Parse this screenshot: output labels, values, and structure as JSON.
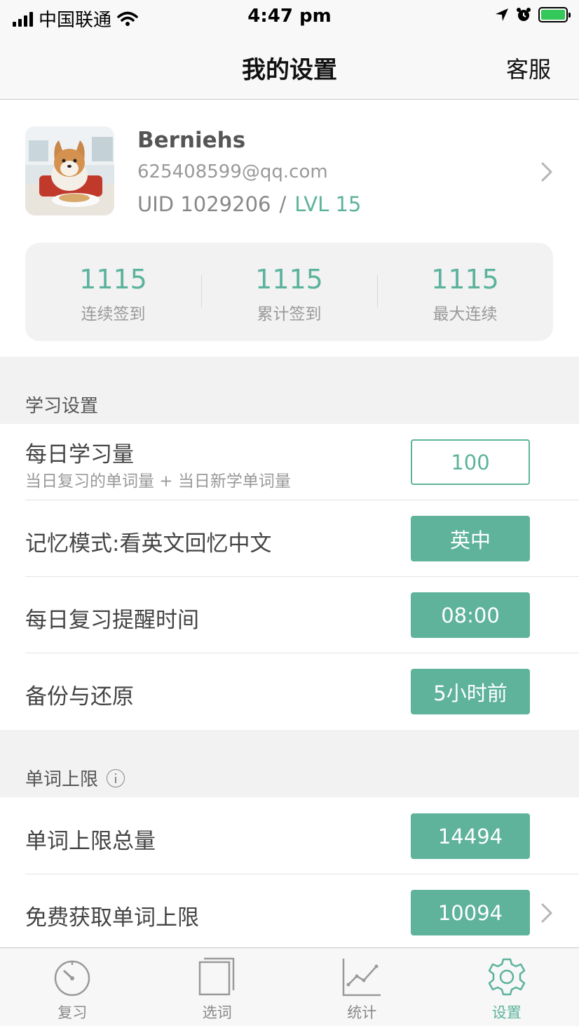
{
  "status_bar": {
    "carrier": "中国联通",
    "time": "4:47 pm"
  },
  "nav": {
    "title": "我的设置",
    "service": "客服"
  },
  "profile": {
    "name": "Berniehs",
    "email": "625408599@qq.com",
    "uid": "UID 1029206",
    "separator": "/",
    "level": "LVL 15"
  },
  "stats": [
    {
      "value": "1115",
      "label": "连续签到"
    },
    {
      "value": "1115",
      "label": "累计签到"
    },
    {
      "value": "1115",
      "label": "最大连续"
    }
  ],
  "study_settings": {
    "title": "学习设置",
    "daily_amount": {
      "label": "每日学习量",
      "sub": "当日复习的单词量 + 当日新学单词量",
      "value": "100"
    },
    "memory_mode": {
      "label": "记忆模式:看英文回忆中文",
      "value": "英中"
    },
    "reminder": {
      "label": "每日复习提醒时间",
      "value": "08:00"
    },
    "backup": {
      "label": "备份与还原",
      "value": "5小时前"
    }
  },
  "word_limit": {
    "title": "单词上限",
    "total": {
      "label": "单词上限总量",
      "value": "14494"
    },
    "free": {
      "label": "免费获取单词上限",
      "value": "10094"
    }
  },
  "tabs": [
    {
      "label": "复习",
      "icon": "timer-icon",
      "active": false
    },
    {
      "label": "选词",
      "icon": "cards-icon",
      "active": false
    },
    {
      "label": "统计",
      "icon": "chart-icon",
      "active": false
    },
    {
      "label": "设置",
      "icon": "gear-icon",
      "active": true
    }
  ],
  "colors": {
    "accent": "#5cb39c",
    "section_bg": "#f2f2f2"
  }
}
